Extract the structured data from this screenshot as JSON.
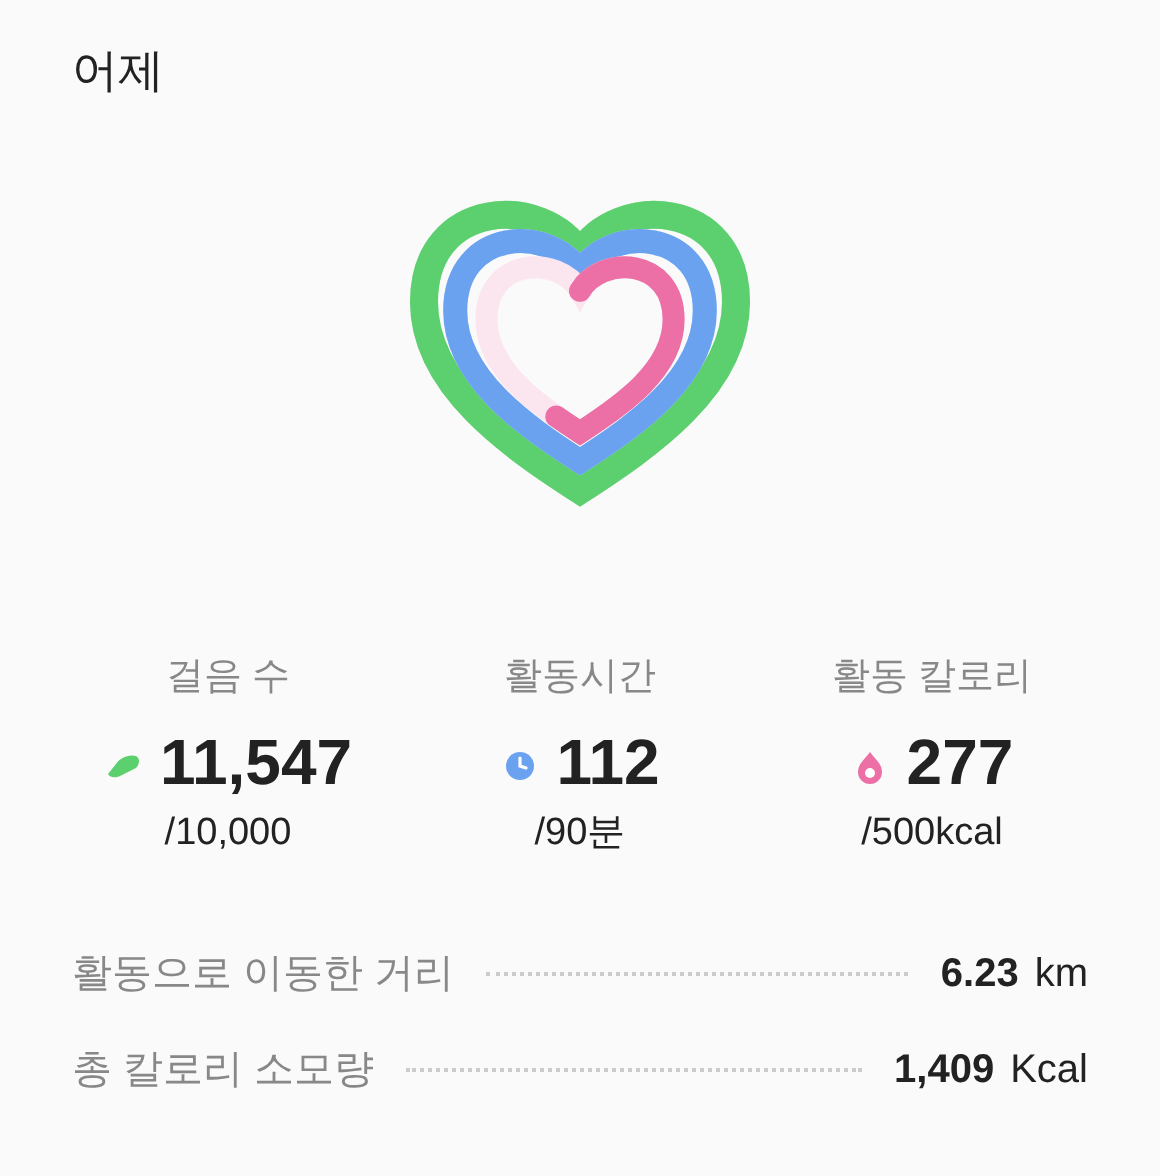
{
  "title": "어제",
  "rings": [
    {
      "kind": "steps",
      "color": "#5ccf6e"
    },
    {
      "kind": "time",
      "color": "#6aa2f0"
    },
    {
      "kind": "calories",
      "color": "#ec6fa6"
    }
  ],
  "stats": [
    {
      "kind": "steps",
      "label": "걸음 수",
      "value": "11,547",
      "goal": "/10,000",
      "color": "#5ccf6e"
    },
    {
      "kind": "time",
      "label": "활동시간",
      "value": "112",
      "goal": "/90분",
      "color": "#6aa2f0"
    },
    {
      "kind": "calories",
      "label": "활동 칼로리",
      "value": "277",
      "goal": "/500kcal",
      "color": "#ec6fa6"
    }
  ],
  "details": [
    {
      "label": "활동으로 이동한 거리",
      "value": "6.23",
      "unit": "km"
    },
    {
      "label": "총 칼로리 소모량",
      "value": "1,409",
      "unit": "Kcal"
    }
  ]
}
